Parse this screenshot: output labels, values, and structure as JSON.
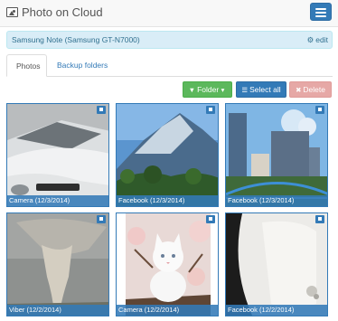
{
  "app": {
    "title": "Photo on Cloud"
  },
  "device": {
    "name": "Samsung Note (Samsung GT-N7000)",
    "edit_label": "edit"
  },
  "tabs": [
    {
      "label": "Photos",
      "active": true
    },
    {
      "label": "Backup folders",
      "active": false
    }
  ],
  "toolbar": {
    "folder_label": "Folder",
    "select_all_label": "Select all",
    "delete_label": "Delete"
  },
  "photos": [
    {
      "caption": "Camera (12/3/2014)",
      "icon": "car-photo"
    },
    {
      "caption": "Facebook (12/3/2014)",
      "icon": "mountain-photo"
    },
    {
      "caption": "Facebook (12/3/2014)",
      "icon": "city-photo"
    },
    {
      "caption": "Viber (12/2/2014)",
      "icon": "tornado-photo"
    },
    {
      "caption": "Camera (12/2/2014)",
      "icon": "kitten-photo"
    },
    {
      "caption": "Facebook (12/2/2014)",
      "icon": "white-object-photo"
    }
  ],
  "colors": {
    "primary": "#337ab7",
    "success": "#5cb85c",
    "danger": "#d9534f",
    "info_bg": "#d9edf7"
  }
}
